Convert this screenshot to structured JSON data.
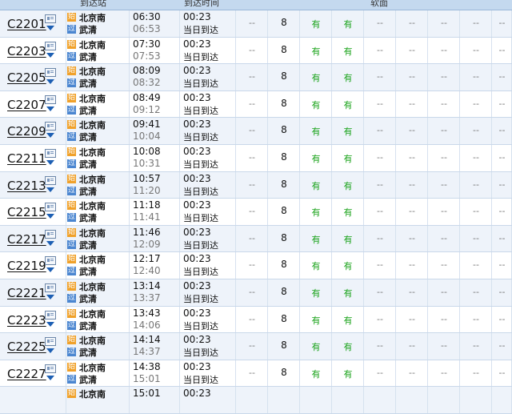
{
  "header": {
    "col_station": "到达站",
    "col_time": "到达时间",
    "col_soft": "软面"
  },
  "labels": {
    "start_badge": "始",
    "pass_badge": "过",
    "from_station": "北京南",
    "to_station": "武清",
    "dash": "--",
    "have": "有"
  },
  "rows": [
    {
      "train": "C2201",
      "dep": "06:30",
      "arr": "06:53",
      "dur": "00:23",
      "arrive": "当日到达",
      "second": "8"
    },
    {
      "train": "C2203",
      "dep": "07:30",
      "arr": "07:53",
      "dur": "00:23",
      "arrive": "当日到达",
      "second": "8"
    },
    {
      "train": "C2205",
      "dep": "08:09",
      "arr": "08:32",
      "dur": "00:23",
      "arrive": "当日到达",
      "second": "8"
    },
    {
      "train": "C2207",
      "dep": "08:49",
      "arr": "09:12",
      "dur": "00:23",
      "arrive": "当日到达",
      "second": "8"
    },
    {
      "train": "C2209",
      "dep": "09:41",
      "arr": "10:04",
      "dur": "00:23",
      "arrive": "当日到达",
      "second": "8"
    },
    {
      "train": "C2211",
      "dep": "10:08",
      "arr": "10:31",
      "dur": "00:23",
      "arrive": "当日到达",
      "second": "8"
    },
    {
      "train": "C2213",
      "dep": "10:57",
      "arr": "11:20",
      "dur": "00:23",
      "arrive": "当日到达",
      "second": "8"
    },
    {
      "train": "C2215",
      "dep": "11:18",
      "arr": "11:41",
      "dur": "00:23",
      "arrive": "当日到达",
      "second": "8"
    },
    {
      "train": "C2217",
      "dep": "11:46",
      "arr": "12:09",
      "dur": "00:23",
      "arrive": "当日到达",
      "second": "8"
    },
    {
      "train": "C2219",
      "dep": "12:17",
      "arr": "12:40",
      "dur": "00:23",
      "arrive": "当日到达",
      "second": "8"
    },
    {
      "train": "C2221",
      "dep": "13:14",
      "arr": "13:37",
      "dur": "00:23",
      "arrive": "当日到达",
      "second": "8"
    },
    {
      "train": "C2223",
      "dep": "13:43",
      "arr": "14:06",
      "dur": "00:23",
      "arrive": "当日到达",
      "second": "8"
    },
    {
      "train": "C2225",
      "dep": "14:14",
      "arr": "14:37",
      "dur": "00:23",
      "arrive": "当日到达",
      "second": "8"
    },
    {
      "train": "C2227",
      "dep": "14:38",
      "arr": "15:01",
      "dur": "00:23",
      "arrive": "当日到达",
      "second": "8"
    },
    {
      "train": "",
      "dep": "15:01",
      "arr": "",
      "dur": "00:23",
      "arrive": "",
      "second": ""
    }
  ],
  "colors": {
    "header_bg": "#c4d9ef",
    "row_alt": "#eef3fa",
    "available_green": "#18a218",
    "link_blue": "#1d5fb3"
  }
}
